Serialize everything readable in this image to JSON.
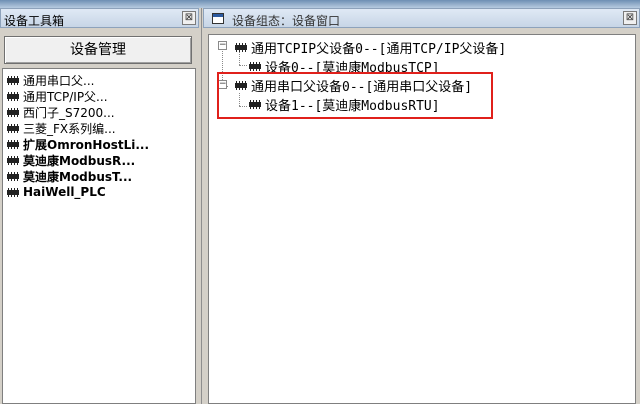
{
  "toolbox": {
    "title": "设备工具箱",
    "close_glyph": "⊠",
    "manage_button": "设备管理",
    "items": [
      {
        "label": "通用串口父...",
        "bold": false,
        "icon": "chip-icon"
      },
      {
        "label": "通用TCP/IP父...",
        "bold": false,
        "icon": "chip-icon"
      },
      {
        "label": "西门子_S7200...",
        "bold": false,
        "icon": "chip-icon"
      },
      {
        "label": "三菱_FX系列编...",
        "bold": false,
        "icon": "chip-icon"
      },
      {
        "label": "扩展OmronHostLi...",
        "bold": true,
        "icon": "chip-icon"
      },
      {
        "label": "莫迪康ModbusR...",
        "bold": true,
        "icon": "chip-icon"
      },
      {
        "label": "莫迪康ModbusT...",
        "bold": true,
        "icon": "chip-icon"
      },
      {
        "label": "HaiWell_PLC",
        "bold": true,
        "icon": "chip-icon"
      }
    ]
  },
  "config_window": {
    "title": "设备组态：设备窗口",
    "close_glyph": "⊠",
    "controls": [
      "▭",
      "▫",
      "✕"
    ],
    "tree": {
      "parent1": {
        "expander": "−",
        "label": "通用TCPIP父设备0--[通用TCP/IP父设备]"
      },
      "child1": {
        "label": "设备0--[莫迪康ModbusTCP]"
      },
      "parent2": {
        "expander": "−",
        "label": "通用串口父设备0--[通用串口父设备]"
      },
      "child2": {
        "label": "设备1--[莫迪康ModbusRTU]"
      }
    },
    "highlight_color": "#e0201b"
  }
}
